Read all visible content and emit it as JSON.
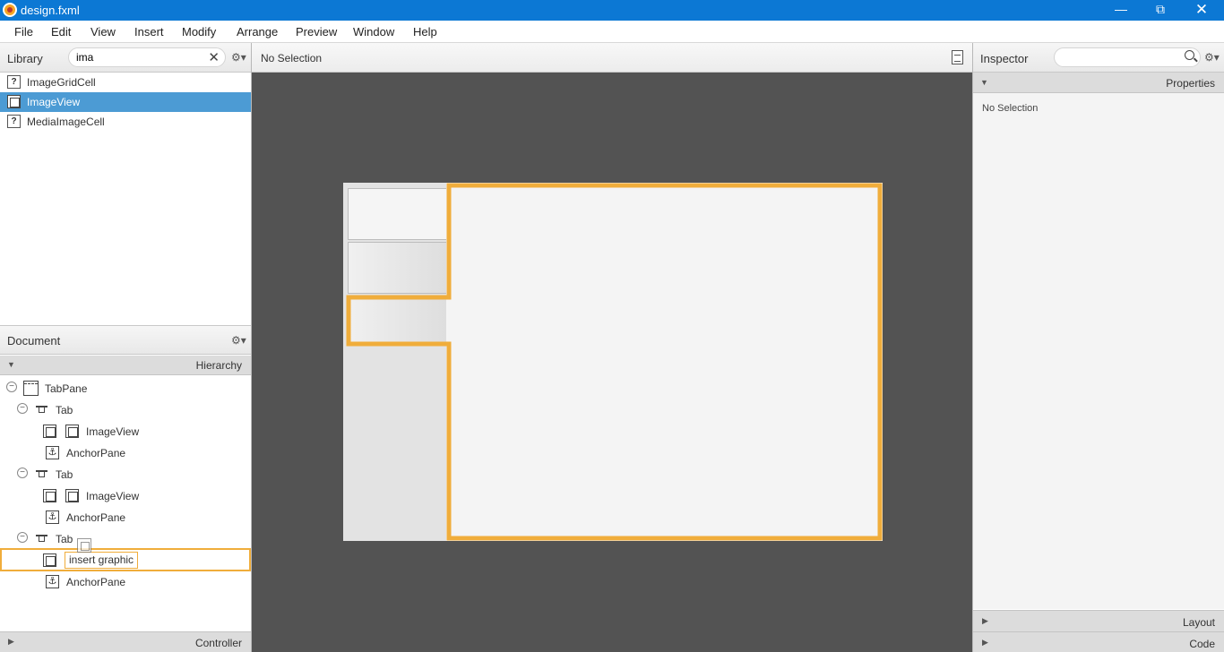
{
  "window": {
    "title": "design.fxml"
  },
  "menu": [
    "File",
    "Edit",
    "View",
    "Insert",
    "Modify",
    "Arrange",
    "Preview",
    "Window",
    "Help"
  ],
  "library": {
    "title": "Library",
    "search_value": "ima",
    "items": [
      {
        "label": "ImageGridCell",
        "icon": "unknown-icon"
      },
      {
        "label": "ImageView",
        "icon": "imageview-icon",
        "selected": true
      },
      {
        "label": "MediaImageCell",
        "icon": "unknown-icon"
      }
    ]
  },
  "document": {
    "title": "Document",
    "section": "Hierarchy",
    "tree": [
      {
        "label": "TabPane",
        "icon": "tabpane-icon"
      },
      {
        "label": "Tab",
        "icon": "tab-icon",
        "graphic": "ImageView",
        "content": "AnchorPane"
      },
      {
        "label": "Tab",
        "icon": "tab-icon",
        "graphic": "ImageView",
        "content": "AnchorPane"
      },
      {
        "label": "Tab",
        "icon": "tab-icon",
        "graphic_placeholder": "insert graphic",
        "content": "AnchorPane"
      }
    ],
    "controller": "Controller"
  },
  "center": {
    "selection": "No Selection"
  },
  "inspector": {
    "title": "Inspector",
    "search_value": "",
    "properties": "Properties",
    "message": "No Selection",
    "layout": "Layout",
    "code": "Code"
  },
  "colors": {
    "titlebar": "#0c78d4",
    "selection_blue": "#4c9bd4",
    "drop_highlight": "#f0ad3b",
    "canvas": "#535353"
  }
}
